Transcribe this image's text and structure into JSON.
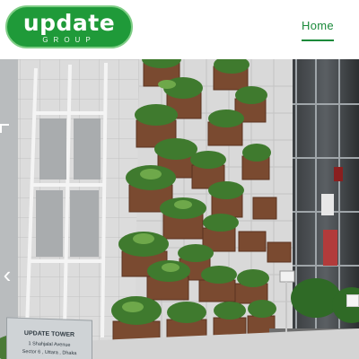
{
  "header": {
    "logo": {
      "word": "update",
      "sub": "GROUP"
    },
    "nav": [
      {
        "label": "Home",
        "active": true
      }
    ]
  },
  "hero": {
    "sign": {
      "line1": "UPDATE TOWER",
      "line2": "1 Shahjalal Avenue",
      "line3": "Sector 6 , Uttara , Dhaka"
    },
    "controls": {
      "prev_icon": "chevron-left-icon",
      "next_icon": "slider-next-icon"
    }
  },
  "colors": {
    "brand_green": "#1f9a39",
    "nav_green": "#1a8a3a"
  }
}
